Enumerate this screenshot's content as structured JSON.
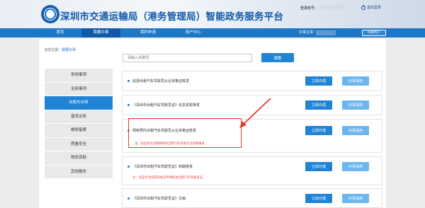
{
  "header": {
    "title": "深圳市交通运输局（港务管理局）智能政务服务平台",
    "login_label": "登录账号：",
    "logout": "退出登录"
  },
  "nav": {
    "tabs": [
      {
        "label": "首页",
        "active": false
      },
      {
        "label": "我要办事",
        "active": true
      },
      {
        "label": "我的申请",
        "active": false
      },
      {
        "label": "用户中心",
        "active": false
      }
    ],
    "user_label": "办事主体：",
    "switch_user": "切换用户"
  },
  "breadcrumb": {
    "prefix": "当前位置：",
    "current": "我要办事"
  },
  "search": {
    "placeholder": "请输入关键词",
    "button": "搜索"
  },
  "sidebar": {
    "items": [
      {
        "label": "常用事项",
        "active": false
      },
      {
        "label": "全部事项",
        "active": false
      },
      {
        "label": "出租车业务",
        "active": true
      },
      {
        "label": "普货业务",
        "active": false
      },
      {
        "label": "维修备案",
        "active": false
      },
      {
        "label": "质量安全",
        "active": false
      },
      {
        "label": "物流资助",
        "active": false
      },
      {
        "label": "其他服务",
        "active": false
      }
    ]
  },
  "services": [
    {
      "title": "巡游出租汽车驾驶员从业资格证核发",
      "note": ""
    },
    {
      "title": "《深圳市出租汽车驾驶员证》信息变更换发",
      "note": ""
    },
    {
      "title": "网络预约出租汽车驾驶员从业资格证核发",
      "note": "注：该业务包含网络预约出租汽车驾驶员证到期换发"
    },
    {
      "title": "《深圳市出租汽车驾驶员证》到期换发",
      "note": "注：该业务为巡游驾驶员申请核发出租汽车驾驶员证。"
    },
    {
      "title": "《深圳市出租汽车驾驶员证》注销",
      "note": ""
    }
  ],
  "row_buttons": {
    "apply": "立即办理",
    "guide": "办事指南"
  },
  "colors": {
    "primary": "#1d77c7",
    "annotation": "#e53b2f"
  }
}
